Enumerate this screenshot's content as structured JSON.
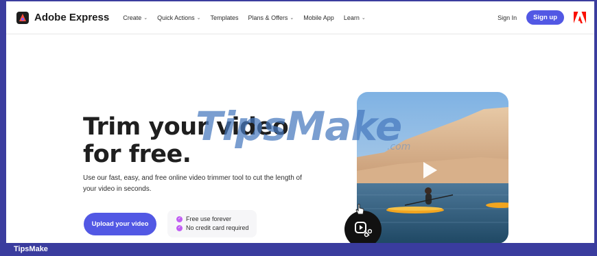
{
  "header": {
    "brand": "Adobe Express",
    "menu": [
      {
        "label": "Create",
        "has_dropdown": true
      },
      {
        "label": "Quick Actions",
        "has_dropdown": true
      },
      {
        "label": "Templates",
        "has_dropdown": false
      },
      {
        "label": "Plans & Offers",
        "has_dropdown": true
      },
      {
        "label": "Mobile App",
        "has_dropdown": false
      },
      {
        "label": "Learn",
        "has_dropdown": true
      }
    ],
    "sign_in": "Sign In",
    "sign_up": "Sign up",
    "logo_icon": "adobe-logo-icon"
  },
  "hero": {
    "title": "Trim your video for free.",
    "description": "Use our fast, easy, and free online video trimmer tool to cut the length of your video in seconds.",
    "cta": "Upload your video",
    "perks": [
      "Free use forever",
      "No credit card required"
    ]
  },
  "media": {
    "play_icon": "play-icon",
    "trim_icon": "video-trim-icon"
  },
  "watermark": {
    "text": "TipsMake",
    "suffix": ".com"
  },
  "footer": {
    "text": "TipsMake"
  },
  "colors": {
    "accent": "#5258e4",
    "frame": "#3b3d9e",
    "check": "#c05ef3",
    "adobe_red": "#fa0f00"
  }
}
